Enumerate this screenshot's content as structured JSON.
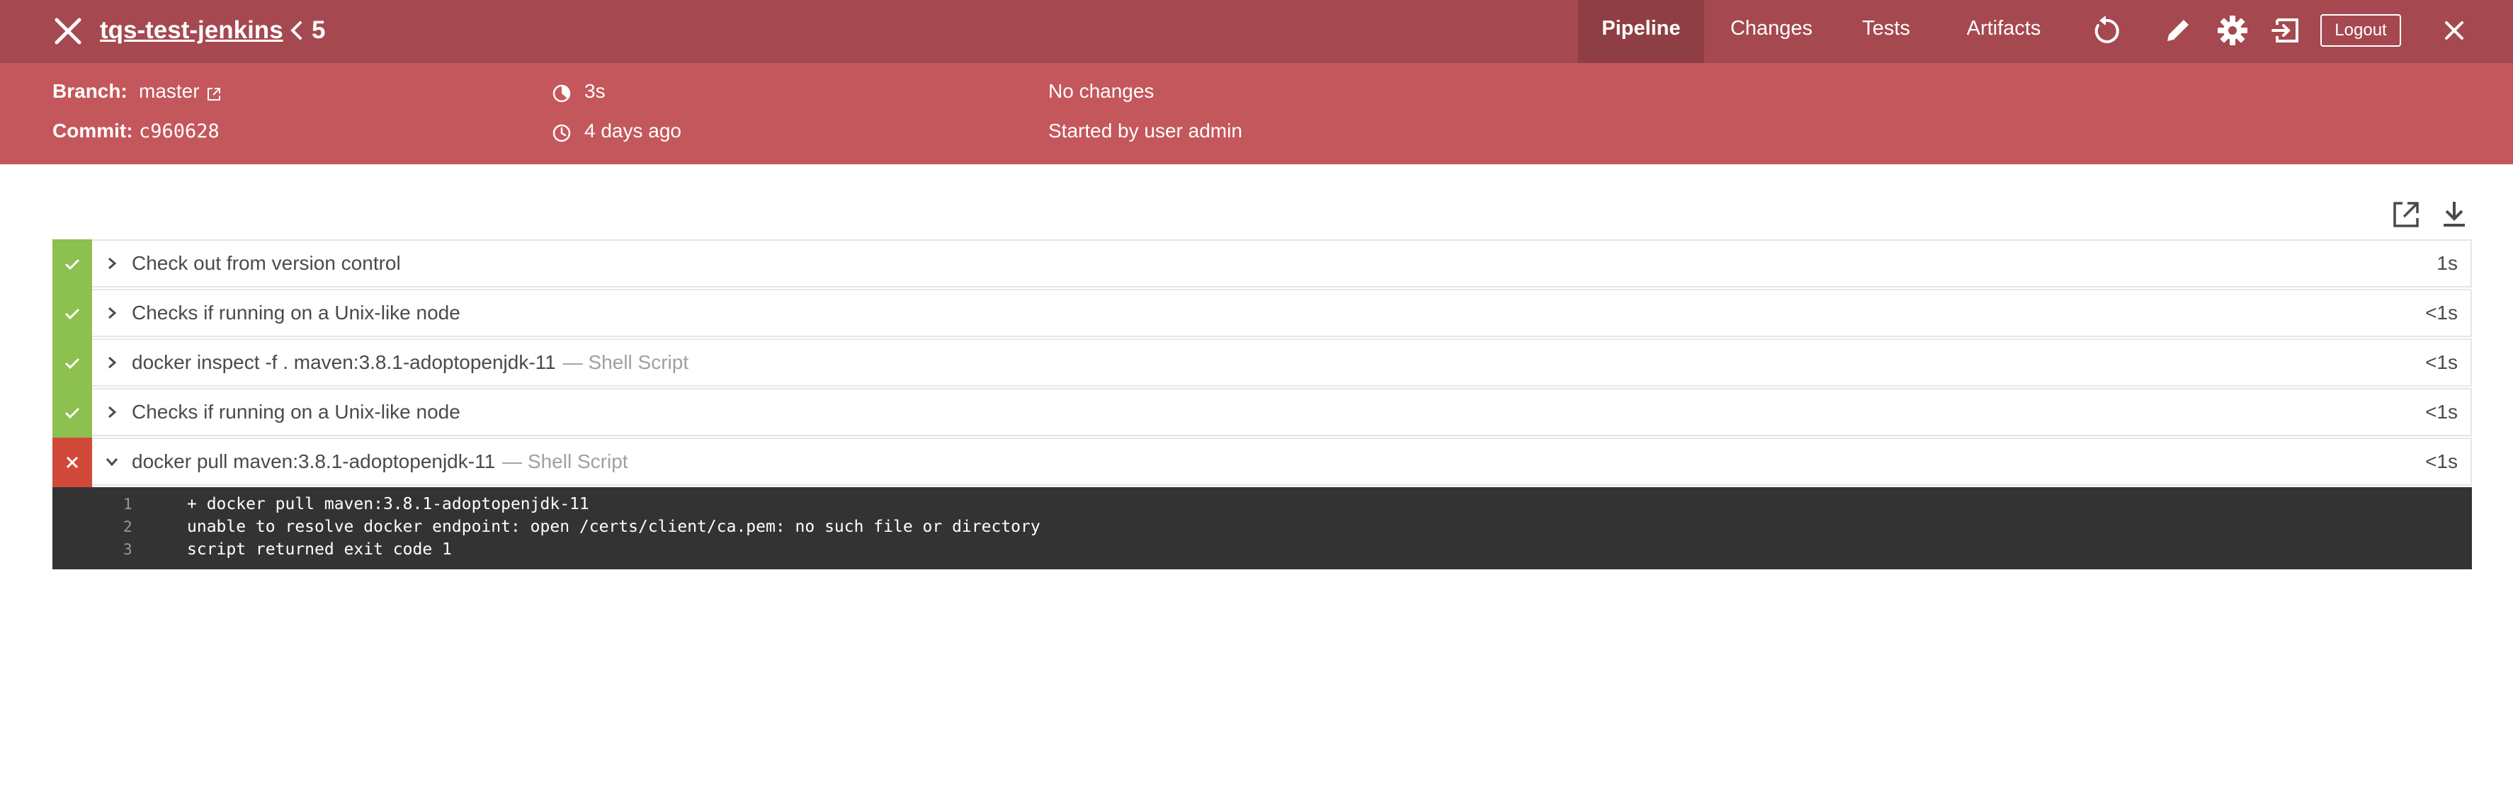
{
  "header": {
    "title": "tqs-test-jenkins",
    "run_number": "5",
    "tabs": [
      {
        "label": "Pipeline",
        "active": true
      },
      {
        "label": "Changes",
        "active": false
      },
      {
        "label": "Tests",
        "active": false
      },
      {
        "label": "Artifacts",
        "active": false
      }
    ],
    "actions": [
      "replay-icon",
      "edit-icon",
      "gear-icon",
      "exit-icon"
    ],
    "logout_label": "Logout"
  },
  "summary": {
    "branch_label": "Branch:",
    "branch_value": "master",
    "commit_label": "Commit:",
    "commit_value": "c960628",
    "duration": "3s",
    "started_ago": "4 days ago",
    "changes": "No changes",
    "started_by": "Started by user admin"
  },
  "steps": [
    {
      "status": "success",
      "name": "Check out from version control",
      "hint": "",
      "duration": "1s",
      "expanded": false
    },
    {
      "status": "success",
      "name": "Checks if running on a Unix-like node",
      "hint": "",
      "duration": "<1s",
      "expanded": false
    },
    {
      "status": "success",
      "name": "docker inspect -f . maven:3.8.1-adoptopenjdk-11",
      "hint": "— Shell Script",
      "duration": "<1s",
      "expanded": false
    },
    {
      "status": "success",
      "name": "Checks if running on a Unix-like node",
      "hint": "",
      "duration": "<1s",
      "expanded": false
    },
    {
      "status": "failure",
      "name": "docker pull maven:3.8.1-adoptopenjdk-11",
      "hint": "— Shell Script",
      "duration": "<1s",
      "expanded": true
    }
  ],
  "log": [
    {
      "n": "1",
      "text": "+ docker pull maven:3.8.1-adoptopenjdk-11"
    },
    {
      "n": "2",
      "text": "unable to resolve docker endpoint: open /certs/client/ca.pem: no such file or directory"
    },
    {
      "n": "3",
      "text": "script returned exit code 1"
    }
  ],
  "colors": {
    "topbar": "#a5484f",
    "summary": "#c4575b",
    "success": "#8cc04f",
    "failure": "#d24939",
    "log_bg": "#333333"
  }
}
